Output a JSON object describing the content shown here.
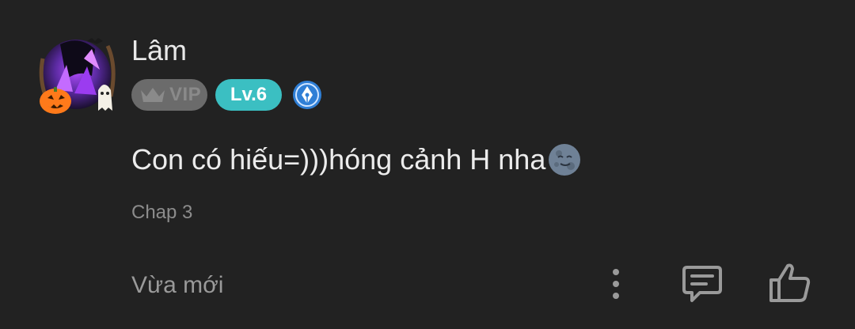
{
  "comment": {
    "author": "Lâm",
    "badges": {
      "vip_label": "VIP",
      "level_label": "Lv.6",
      "pen_icon": "pen-badge-icon"
    },
    "text": "Con có hiếu=)))hóng cảnh H nha",
    "emoji": "new-moon-face-emoji",
    "chapter": "Chap 3",
    "timestamp": "Vừa mới"
  },
  "actions": {
    "more": "more-vertical-icon",
    "reply": "comment-reply-icon",
    "like": "thumbs-up-icon"
  },
  "colors": {
    "background": "#222222",
    "vip_badge": "#6b6b6b",
    "level_badge": "#3bbfc2",
    "pen_badge": "#2f7fd6",
    "icon": "#9a9a9a"
  }
}
